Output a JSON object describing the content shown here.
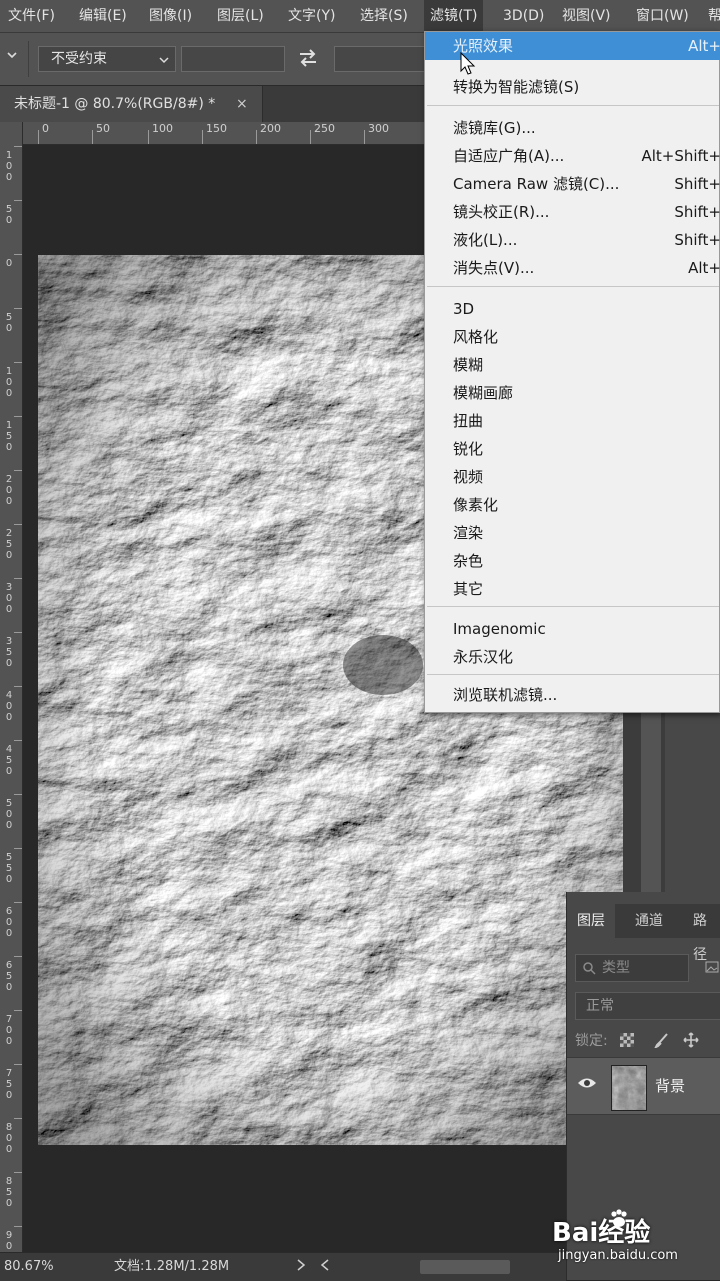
{
  "menubar": {
    "items": [
      "文件(F)",
      "编辑(E)",
      "图像(I)",
      "图层(L)",
      "文字(Y)",
      "选择(S)",
      "滤镜(T)",
      "3D(D)",
      "视图(V)",
      "窗口(W)",
      "帮"
    ],
    "active_item": "滤镜(T)"
  },
  "options_bar": {
    "constraint_select": "不受约束"
  },
  "document_tab": {
    "title": "未标题-1 @ 80.7%(RGB/8#) *",
    "close": "×"
  },
  "ruler_top": {
    "ticks": [
      "0",
      "50",
      "100",
      "150",
      "200",
      "250",
      "300"
    ]
  },
  "ruler_left": {
    "ticks": [
      "100",
      "50",
      "0",
      "50",
      "100",
      "150",
      "200",
      "250",
      "300",
      "350",
      "400",
      "450",
      "500",
      "550",
      "600",
      "650",
      "700",
      "750",
      "800",
      "850",
      "900"
    ]
  },
  "filter_menu": {
    "items": [
      {
        "label": "光照效果",
        "shortcut": "Alt+"
      },
      {
        "label": "转换为智能滤镜(S)",
        "shortcut": ""
      },
      {
        "label": "滤镜库(G)...",
        "shortcut": ""
      },
      {
        "label": "自适应广角(A)...",
        "shortcut": "Alt+Shift+"
      },
      {
        "label": "Camera Raw 滤镜(C)...",
        "shortcut": "Shift+"
      },
      {
        "label": "镜头校正(R)...",
        "shortcut": "Shift+"
      },
      {
        "label": "液化(L)...",
        "shortcut": "Shift+"
      },
      {
        "label": "消失点(V)...",
        "shortcut": "Alt+"
      },
      {
        "label": "3D",
        "shortcut": ""
      },
      {
        "label": "风格化",
        "shortcut": ""
      },
      {
        "label": "模糊",
        "shortcut": ""
      },
      {
        "label": "模糊画廊",
        "shortcut": ""
      },
      {
        "label": "扭曲",
        "shortcut": ""
      },
      {
        "label": "锐化",
        "shortcut": ""
      },
      {
        "label": "视频",
        "shortcut": ""
      },
      {
        "label": "像素化",
        "shortcut": ""
      },
      {
        "label": "渲染",
        "shortcut": ""
      },
      {
        "label": "杂色",
        "shortcut": ""
      },
      {
        "label": "其它",
        "shortcut": ""
      },
      {
        "label": "Imagenomic",
        "shortcut": ""
      },
      {
        "label": "永乐汉化",
        "shortcut": ""
      },
      {
        "label": "浏览联机滤镜...",
        "shortcut": ""
      }
    ],
    "highlighted": "光照效果"
  },
  "layers_panel": {
    "tabs": [
      "图层",
      "通道",
      "路径"
    ],
    "search_placeholder": "类型",
    "blend_mode": "正常",
    "lock_label": "锁定:",
    "layer_name": "背景"
  },
  "status_bar": {
    "zoom": "80.67%",
    "doc_info": "文档:1.28M/1.28M"
  },
  "watermark": {
    "brand": "Bai经验",
    "url": "jingyan.baidu.com"
  },
  "colors": {
    "menu_highlight": "#3f8fd6",
    "menu_bg": "#f0f0f0",
    "panel_bg": "#535353",
    "workspace_bg": "#282828"
  }
}
